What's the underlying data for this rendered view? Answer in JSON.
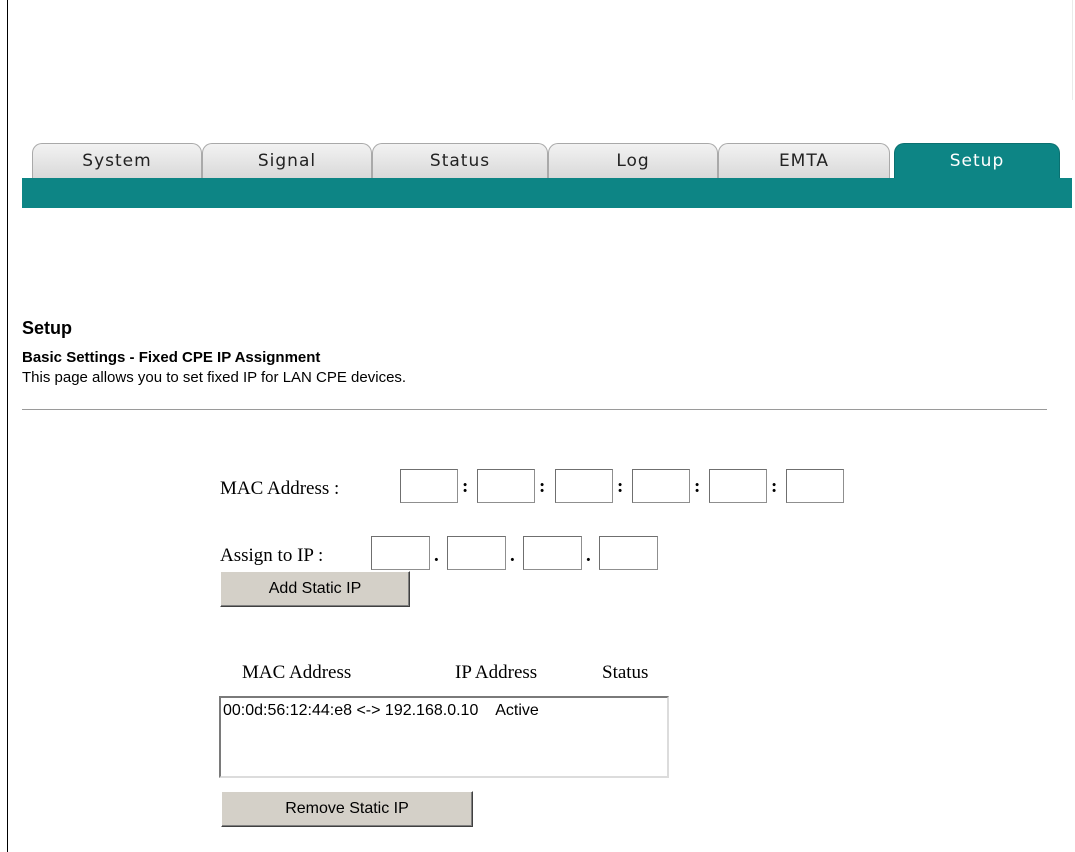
{
  "tabs": [
    {
      "label": "System",
      "active": false
    },
    {
      "label": "Signal",
      "active": false
    },
    {
      "label": "Status",
      "active": false
    },
    {
      "label": "Log",
      "active": false
    },
    {
      "label": "EMTA",
      "active": false
    },
    {
      "label": "Setup",
      "active": true
    }
  ],
  "colors": {
    "accent": "#0d8585"
  },
  "page": {
    "title": "Setup",
    "subtitle": "Basic Settings - Fixed CPE IP Assignment",
    "description": "This page allows you to set fixed IP for LAN CPE devices."
  },
  "form": {
    "mac_label": "MAC Address :",
    "mac_separator": ":",
    "mac_values": [
      "",
      "",
      "",
      "",
      "",
      ""
    ],
    "ip_label": "Assign to IP :",
    "ip_separator": ".",
    "ip_values": [
      "",
      "",
      "",
      ""
    ],
    "add_button": "Add Static IP"
  },
  "list": {
    "headers": {
      "mac": "MAC Address",
      "ip": "IP Address",
      "status": "Status"
    },
    "items": [
      "00:0d:56:12:44:e8 <-> 192.168.0.10    Active"
    ],
    "remove_button": "Remove Static IP"
  }
}
